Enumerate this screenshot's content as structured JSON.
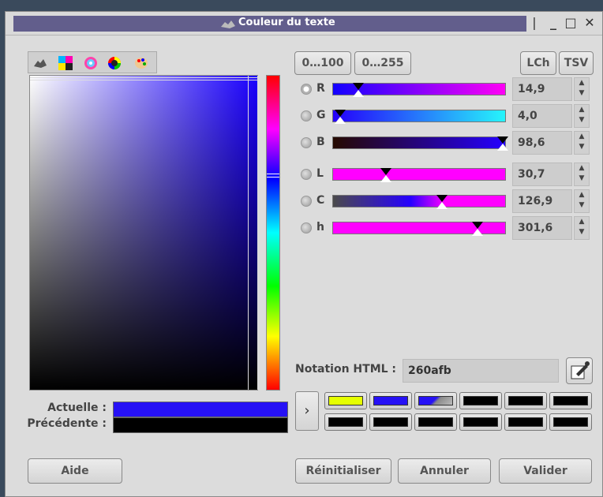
{
  "window": {
    "title": "Couleur du texte"
  },
  "window_controls": {
    "restore": "|",
    "minimize": "_",
    "maximize": "□",
    "close": "✕"
  },
  "range_buttons": {
    "r100": "0…100",
    "r255": "0…255"
  },
  "mode_buttons": {
    "lch": "LCh",
    "tsv": "TSV"
  },
  "sliders": [
    {
      "label": "R",
      "value": "14,9",
      "level": 0.149,
      "active": true,
      "gradient": "linear-gradient(to right,#1200ff,#ff00f5)"
    },
    {
      "label": "G",
      "value": "4,0",
      "level": 0.04,
      "active": false,
      "gradient": "linear-gradient(to right,#2500fb,#26f5fb)"
    },
    {
      "label": "B",
      "value": "98,6",
      "level": 0.986,
      "active": false,
      "gradient": "linear-gradient(to right,#260a00,#2600ff)"
    },
    {
      "label": "L",
      "value": "30,7",
      "level": 0.307,
      "active": false,
      "gradient": "linear-gradient(to right,#ff00ff,#ff00ff)"
    },
    {
      "label": "C",
      "value": "126,9",
      "level": 0.635,
      "active": false,
      "gradient": "linear-gradient(to right,#4a4a4a,#2600ff 45%,#ff00ff 65%,#ff00ff)"
    },
    {
      "label": "h",
      "value": "301,6",
      "level": 0.838,
      "active": false,
      "gradient": "linear-gradient(to right,#ff00ff,#ff00ff)"
    }
  ],
  "html_notation": {
    "label": "Notation HTML :",
    "value": "260afb"
  },
  "current": {
    "label": "Actuelle :",
    "color": "#2611f5"
  },
  "previous": {
    "label": "Précédente :",
    "color": "#000000"
  },
  "history_colors": [
    [
      "#e6ff00",
      "#2611f5",
      "checker",
      "#000000",
      "#000000",
      "#000000"
    ],
    [
      "#000000",
      "#000000",
      "#000000",
      "#000000",
      "#000000",
      "#000000"
    ]
  ],
  "history_toggle": "›",
  "buttons": {
    "help": "Aide",
    "reset": "Réinitialiser",
    "cancel": "Annuler",
    "ok": "Valider"
  },
  "tab_icons": [
    "gimp-icon",
    "cmyk-icon",
    "watercolor-icon",
    "wheel-icon",
    "palette-icon"
  ]
}
